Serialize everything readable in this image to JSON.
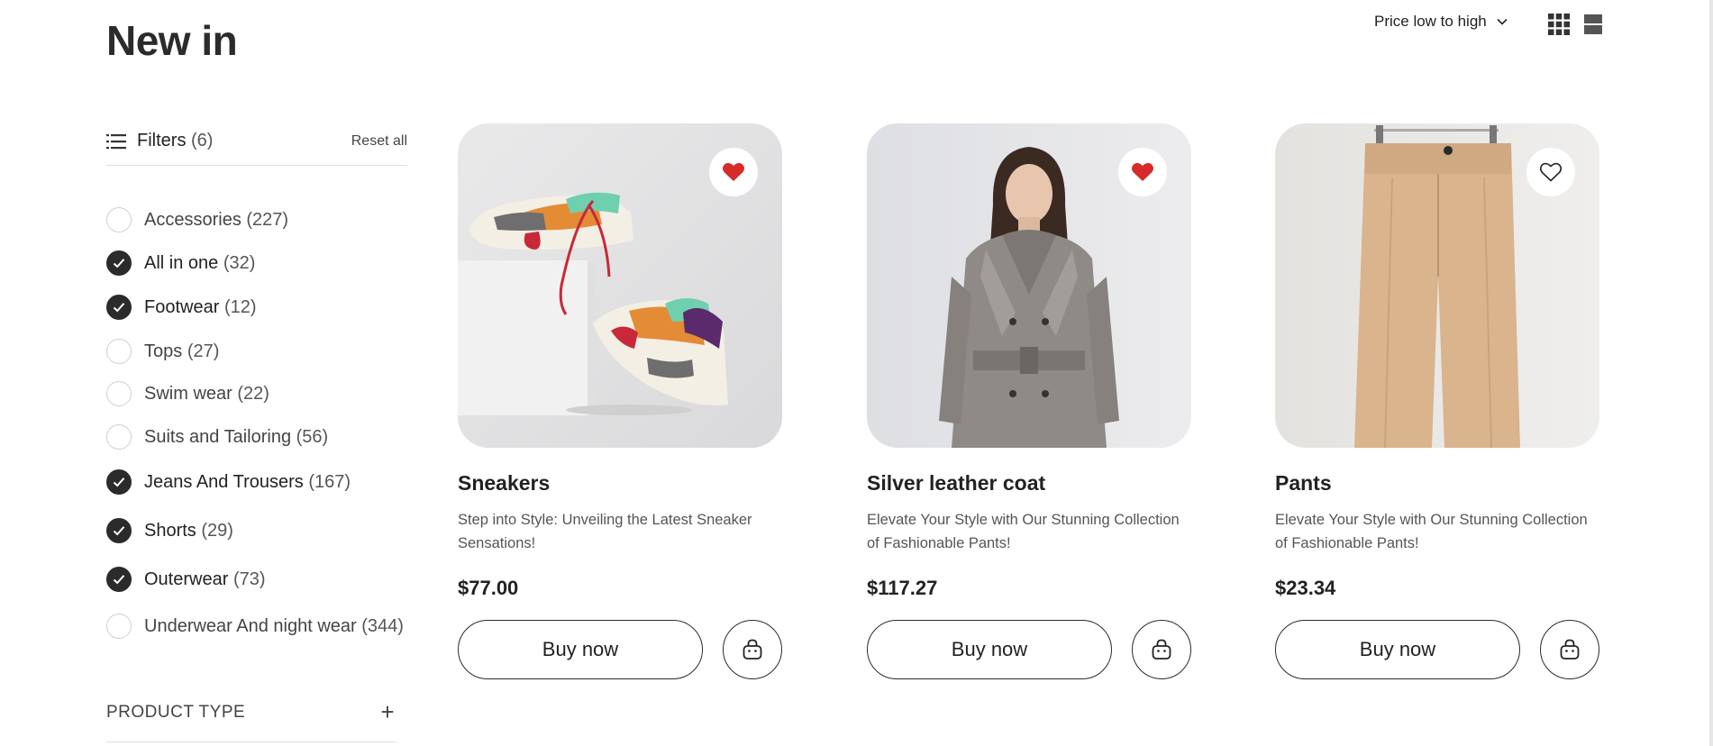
{
  "page": {
    "title": "New in"
  },
  "sort": {
    "label": "Price low to high"
  },
  "icons": {
    "sort_chevron": "chevron-down-icon",
    "grid_view": "grid-view-icon",
    "list_view": "list-view-icon",
    "filters": "list-icon",
    "check": "check-icon",
    "plus": "plus-icon",
    "wishlist_filled": "heart-filled-icon",
    "wishlist_outline": "heart-outline-icon",
    "cart": "shopping-bag-icon"
  },
  "colors": {
    "accent_dark": "#2b2b2b",
    "heart_red": "#d72a2a",
    "border_light": "#dcdcdc"
  },
  "filters": {
    "title": "Filters",
    "count": "(6)",
    "reset_label": "Reset all",
    "items": [
      {
        "label": "Accessories",
        "count": "(227)",
        "checked": false
      },
      {
        "label": "All in one",
        "count": "(32)",
        "checked": true
      },
      {
        "label": "Footwear",
        "count": "(12)",
        "checked": true
      },
      {
        "label": "Tops",
        "count": "(27)",
        "checked": false
      },
      {
        "label": "Swim wear",
        "count": "(22)",
        "checked": false
      },
      {
        "label": "Suits and Tailoring",
        "count": "(56)",
        "checked": false
      },
      {
        "label": "Jeans And Trousers",
        "count": "(167)",
        "checked": true
      },
      {
        "label": "Shorts",
        "count": "(29)",
        "checked": true
      },
      {
        "label": "Outerwear",
        "count": "(73)",
        "checked": true
      },
      {
        "label": "Underwear And night wear",
        "count": "(344)",
        "checked": false
      }
    ],
    "product_type_label": "PRODUCT TYPE",
    "product_type_toggle": "+"
  },
  "products": [
    {
      "name": "Sneakers",
      "description": "Step into Style: Unveiling the Latest Sneaker Sensations!",
      "price": "$77.00",
      "buy_label": "Buy now",
      "wishlisted": true
    },
    {
      "name": "Silver leather coat",
      "description": "Elevate Your Style with Our Stunning Collection of Fashionable Pants!",
      "price": "$117.27",
      "buy_label": "Buy now",
      "wishlisted": true
    },
    {
      "name": "Pants",
      "description": "Elevate Your Style with Our Stunning Collection of Fashionable Pants!",
      "price": "$23.34",
      "buy_label": "Buy now",
      "wishlisted": false
    }
  ]
}
